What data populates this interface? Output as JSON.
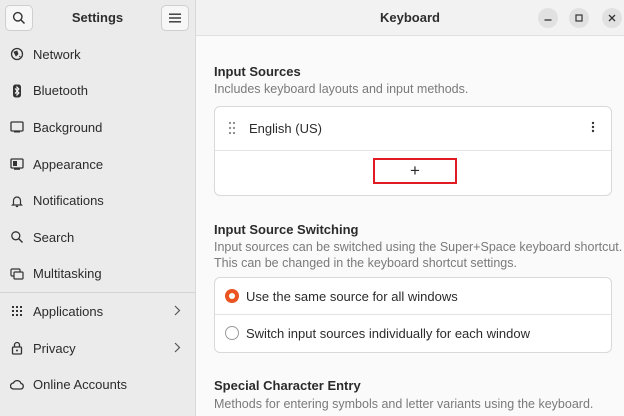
{
  "sidebar": {
    "title": "Settings",
    "items": [
      {
        "label": "Network",
        "icon": "network-icon",
        "chevron": false
      },
      {
        "label": "Bluetooth",
        "icon": "bluetooth-icon",
        "chevron": false
      },
      {
        "label": "Background",
        "icon": "background-icon",
        "chevron": false
      },
      {
        "label": "Appearance",
        "icon": "appearance-icon",
        "chevron": false
      },
      {
        "label": "Notifications",
        "icon": "bell-icon",
        "chevron": false
      },
      {
        "label": "Search",
        "icon": "search-icon",
        "chevron": false
      },
      {
        "label": "Multitasking",
        "icon": "multitasking-icon",
        "chevron": false
      },
      {
        "label": "Applications",
        "icon": "grid-icon",
        "chevron": true
      },
      {
        "label": "Privacy",
        "icon": "lock-icon",
        "chevron": true
      },
      {
        "label": "Online Accounts",
        "icon": "online-accounts-icon",
        "chevron": false
      }
    ]
  },
  "main": {
    "title": "Keyboard",
    "input_sources": {
      "title": "Input Sources",
      "description": "Includes keyboard layouts and input methods.",
      "items": [
        "English (US)"
      ],
      "add_label": "+"
    },
    "switching": {
      "title": "Input Source Switching",
      "description_line1": "Input sources can be switched using the Super+Space keyboard shortcut.",
      "description_line2": "This can be changed in the keyboard shortcut settings.",
      "options": [
        {
          "label": "Use the same source for all windows",
          "selected": true
        },
        {
          "label": "Switch input sources individually for each window",
          "selected": false
        }
      ]
    },
    "special_chars": {
      "title": "Special Character Entry",
      "description": "Methods for entering symbols and letter variants using the keyboard."
    }
  },
  "colors": {
    "accent": "#e95420",
    "highlight_border": "#e01b24"
  }
}
